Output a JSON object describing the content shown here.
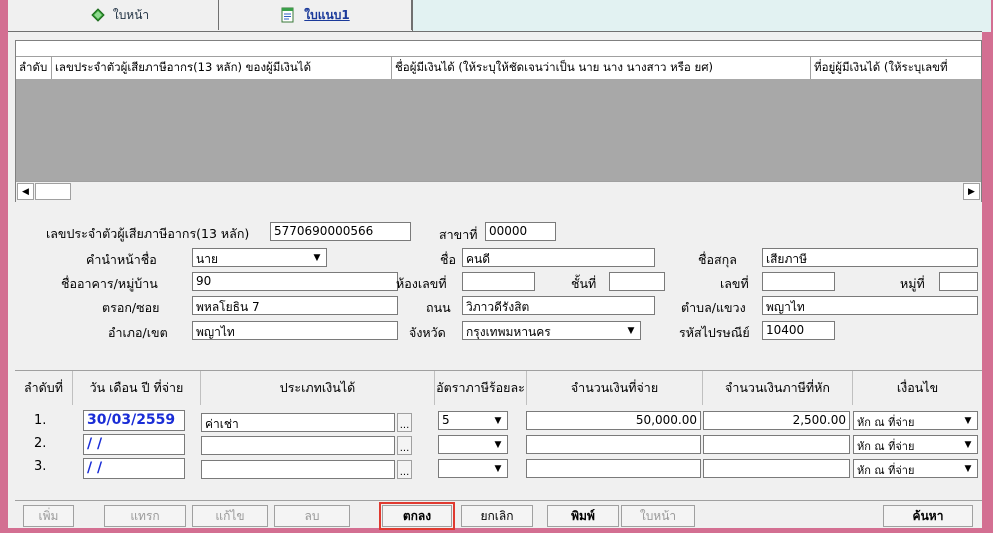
{
  "tabs": [
    {
      "label": "ใบหน้า"
    },
    {
      "label": "ใบแนบ1"
    }
  ],
  "grid": {
    "columns": [
      "ลำดับ",
      "เลขประจำตัวผู้เสียภาษีอากร(13 หลัก) ของผู้มีเงินได้",
      "ชื่อผู้มีเงินได้ (ให้ระบุให้ชัดเจนว่าเป็น นาย นาง นางสาว หรือ ยศ)",
      "ที่อยู่ผู้มีเงินได้ (ให้ระบุเลขที่"
    ]
  },
  "form": {
    "tax_id_label": "เลขประจำตัวผู้เสียภาษีอากร(13 หลัก)",
    "tax_id": "5770690000566",
    "branch_label": "สาขาที่",
    "branch": "00000",
    "prefix_label": "คำนำหน้าชื่อ",
    "prefix": "นาย",
    "name_label": "ชื่อ",
    "name": "คนดี",
    "surname_label": "ชื่อสกุล",
    "surname": "เสียภาษี",
    "building_label": "ชื่ออาคาร/หมู่บ้าน",
    "building": "90",
    "room_label": "ห้องเลขที่",
    "room": "",
    "floor_label": "ชั้นที่",
    "floor": "",
    "house_no_label": "เลขที่",
    "house_no": "",
    "moo_label": "หมู่ที่",
    "moo": "",
    "soi_label": "ตรอก/ซอย",
    "soi": "พหลโยธิน 7",
    "road_label": "ถนน",
    "road": "วิภาวดีรังสิต",
    "subdistrict_label": "ตำบล/แขวง",
    "subdistrict": "พญาไท",
    "district_label": "อำเภอ/เขต",
    "district": "พญาไท",
    "province_label": "จังหวัด",
    "province": "กรุงเทพมหานคร",
    "postal_label": "รหัสไปรษณีย์",
    "postal": "10400"
  },
  "items": {
    "headers": [
      "ลำดับที่",
      "วัน เดือน ปี ที่จ่าย",
      "ประเภทเงินได้",
      "อัตราภาษีร้อยละ",
      "จำนวนเงินที่จ่าย",
      "จำนวนเงินภาษีที่หัก",
      "เงื่อนไข"
    ],
    "rows": [
      {
        "no": "1.",
        "date": "30/03/2559",
        "type": "ค่าเช่า",
        "rate": "5",
        "amount": "50,000.00",
        "tax": "2,500.00",
        "condition": "หัก ณ ที่จ่าย"
      },
      {
        "no": "2.",
        "date": "/ /",
        "type": "",
        "rate": "",
        "amount": "",
        "tax": "",
        "condition": "หัก ณ ที่จ่าย"
      },
      {
        "no": "3.",
        "date": "/ /",
        "type": "",
        "rate": "",
        "amount": "",
        "tax": "",
        "condition": "หัก ณ ที่จ่าย"
      }
    ],
    "dots": "..."
  },
  "buttons": {
    "add": "เพิ่ม",
    "insert": "แทรก",
    "edit": "แก้ไข",
    "delete": "ลบ",
    "ok": "ตกลง",
    "cancel": "ยกเลิก",
    "print": "พิมพ์",
    "front": "ใบหน้า",
    "search": "ค้นหา"
  },
  "colors": {
    "frame": "#d36f92",
    "highlight": "#e03a30",
    "date_text": "#1a2dd6",
    "grid_body": "#a8a8a8"
  },
  "icons": {
    "home_tab": "green-diamond-icon",
    "form_tab": "document-page-icon"
  }
}
